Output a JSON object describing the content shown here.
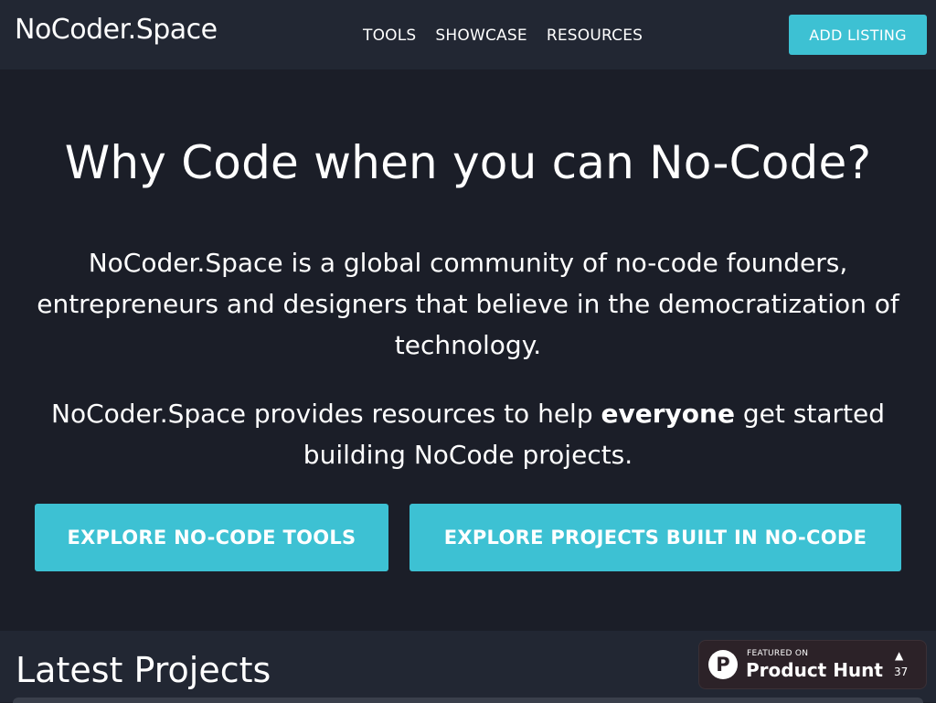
{
  "nav": {
    "brand": "NoCoder.Space",
    "links": [
      "TOOLS",
      "SHOWCASE",
      "RESOURCES"
    ],
    "add_listing": "ADD LISTING"
  },
  "hero": {
    "title": "Why Code when you can No-Code?",
    "paragraph1": "NoCoder.Space is a global community of no-code founders, entrepreneurs and designers that believe in the democratization of technology.",
    "paragraph2_before": "NoCoder.Space provides resources to help ",
    "paragraph2_bold": "everyone",
    "paragraph2_after": " get started building NoCode projects.",
    "cta_tools": "EXPLORE NO-CODE TOOLS",
    "cta_projects": "EXPLORE PROJECTS BUILT IN NO-CODE"
  },
  "latest": {
    "title": "Latest Projects"
  },
  "product_hunt": {
    "logo_letter": "P",
    "featured": "FEATURED ON",
    "name": "Product Hunt",
    "arrow": "▲",
    "count": "37"
  },
  "colors": {
    "accent": "#3dc1d3",
    "background": "#1b1e28",
    "navbar": "#222733",
    "badge": "#2c2228"
  }
}
